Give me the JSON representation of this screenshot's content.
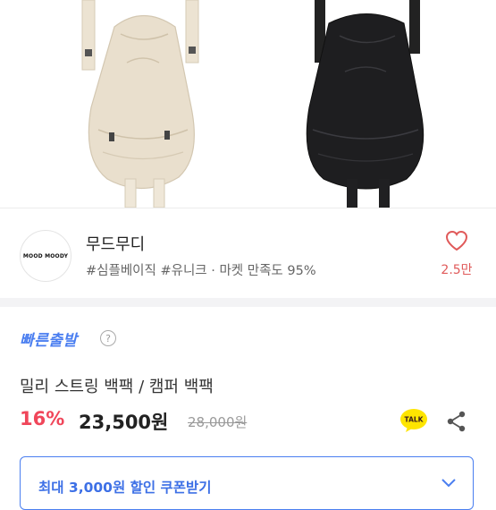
{
  "shop": {
    "logo_text": "MOOD MOODY",
    "name": "무드무디",
    "tags": "#심플베이직 #유니크 · 마켓 만족도 95%",
    "likes": "2.5만"
  },
  "product": {
    "shipping_badge": "빠른출발",
    "help_symbol": "?",
    "title": "밀리 스트링 백팩 / 캠퍼 백팩",
    "discount": "16%",
    "price": "23,500원",
    "original_price": "28,000원",
    "talk_label": "TALK"
  },
  "coupon": {
    "label": "최대 3,000원 할인 쿠폰받기"
  },
  "colors": {
    "accent_blue": "#4a7ef0",
    "discount_red": "#f0465a",
    "heart_red": "#e05a5a",
    "talk_yellow": "#fee500"
  },
  "icons": [
    "heart-icon",
    "help-icon",
    "kakao-talk-icon",
    "share-icon",
    "chevron-down-icon"
  ]
}
